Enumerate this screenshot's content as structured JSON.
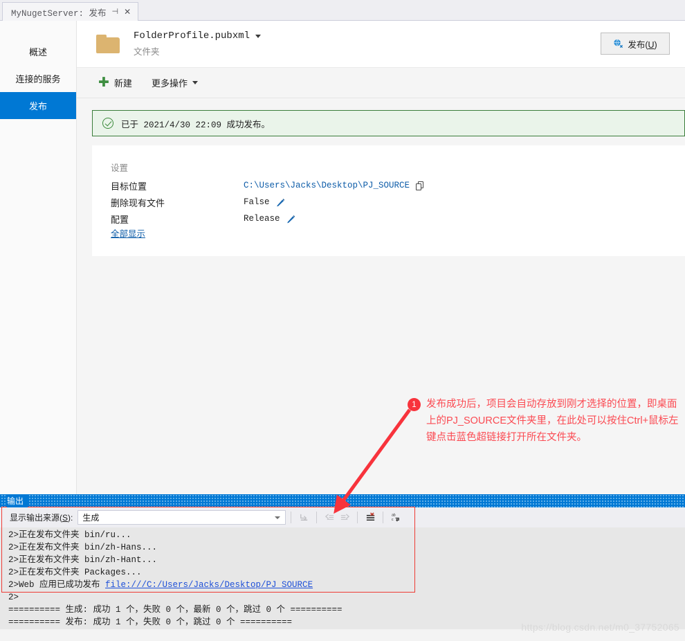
{
  "window": {
    "tab_title": "MyNugetServer: 发布",
    "pin_icon": "pin-icon",
    "close_icon": "close-icon"
  },
  "sidebar": {
    "items": [
      {
        "label": "概述",
        "active": false
      },
      {
        "label": "连接的服务",
        "active": false
      },
      {
        "label": "发布",
        "active": true
      }
    ]
  },
  "profile": {
    "icon": "folder-icon",
    "name": "FolderProfile.pubxml",
    "kind": "文件夹",
    "dropdown_icon": "chevron-down-icon"
  },
  "publish_button": {
    "label_prefix": "发布(",
    "accel": "U",
    "label_suffix": ")",
    "icon": "globe-publish-icon"
  },
  "command_bar": {
    "new_label": "新建",
    "new_icon": "plus-icon",
    "more_label": "更多操作",
    "more_icon": "chevron-down-icon"
  },
  "banner": {
    "icon": "success-check-icon",
    "text": "已于 2021/4/30 22:09 成功发布。"
  },
  "settings": {
    "title": "设置",
    "rows": [
      {
        "key": "目标位置",
        "value": "C:\\Users\\Jacks\\Desktop\\PJ_SOURCE",
        "style": "link",
        "action_icon": "copy-icon"
      },
      {
        "key": "删除现有文件",
        "value": "False",
        "style": "plain",
        "action_icon": "pencil-icon"
      },
      {
        "key": "配置",
        "value": "Release",
        "style": "plain",
        "action_icon": "pencil-icon"
      }
    ],
    "show_all": "全部显示"
  },
  "annotation": {
    "badge": "1",
    "text": "发布成功后，项目会自动存放到刚才选择的位置，即桌面上的PJ_SOURCE文件夹里，在此处可以按住Ctrl+鼠标左键点击蓝色超链接打开所在文件夹。",
    "color": "#fb4a52"
  },
  "output": {
    "caption": "输出",
    "source_label_prefix": "显示输出来源(",
    "source_label_accel": "S",
    "source_label_suffix": "):",
    "source_value": "生成",
    "toolbar_icons": [
      "goto-message-icon",
      "previous-message-icon",
      "next-message-icon",
      "clear-all-icon",
      "word-wrap-icon"
    ],
    "lines": [
      {
        "text": "2>正在发布文件夹 bin/ru...",
        "link": null
      },
      {
        "text": "2>正在发布文件夹 bin/zh-Hans...",
        "link": null
      },
      {
        "text": "2>正在发布文件夹 bin/zh-Hant...",
        "link": null
      },
      {
        "text": "2>正在发布文件夹 Packages...",
        "link": null
      },
      {
        "text": "2>Web 应用已成功发布 ",
        "link": "file:///C:/Users/Jacks/Desktop/PJ_SOURCE"
      },
      {
        "text": "2>",
        "link": null
      },
      {
        "text": "========== 生成: 成功 1 个，失败 0 个，最新 0 个，跳过 0 个 ==========",
        "link": null
      },
      {
        "text": "========== 发布: 成功 1 个，失败 0 个，跳过 0 个 ==========",
        "link": null
      }
    ]
  },
  "watermark": "https://blog.csdn.net/m0_37752065",
  "colors": {
    "accent": "#0078d4",
    "link": "#0d5ca8",
    "success_border": "#3a7d3a",
    "success_bg": "#eaf4ea",
    "annotation_red": "#fb4a52",
    "rect_red": "#ee3b34"
  }
}
